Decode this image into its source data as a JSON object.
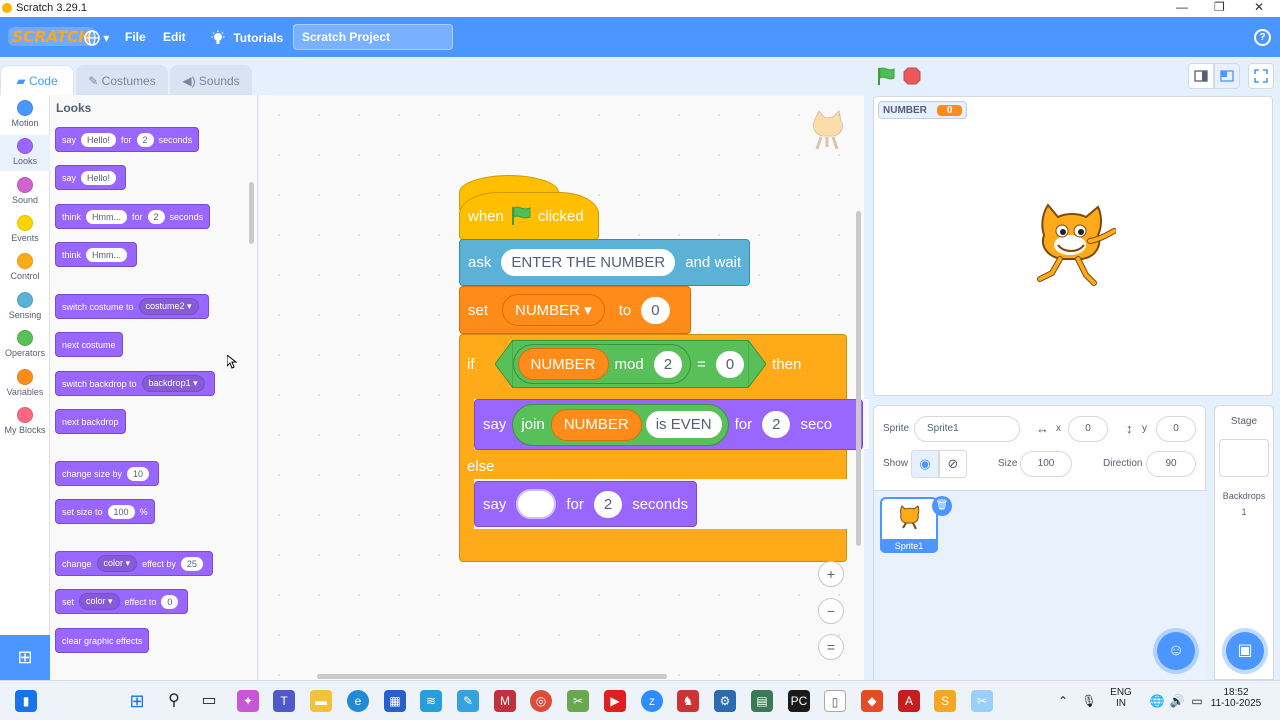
{
  "window": {
    "title": "Scratch 3.29.1",
    "minimize": "—",
    "maximize": "❐",
    "close": "✕"
  },
  "menubar": {
    "logo": "SCRATCH",
    "globe_arrow": "▾",
    "file": "File",
    "edit": "Edit",
    "tutorials": "Tutorials",
    "project_title": "Scratch Project",
    "help": "?"
  },
  "tabs": [
    {
      "label": "Code",
      "active": true
    },
    {
      "label": "Costumes",
      "active": false
    },
    {
      "label": "Sounds",
      "active": false
    }
  ],
  "categories": [
    {
      "label": "Motion",
      "color": "#4c97ff"
    },
    {
      "label": "Looks",
      "color": "#9966ff"
    },
    {
      "label": "Sound",
      "color": "#cf63cf"
    },
    {
      "label": "Events",
      "color": "#ffd500"
    },
    {
      "label": "Control",
      "color": "#ffab19"
    },
    {
      "label": "Sensing",
      "color": "#5cb1d6"
    },
    {
      "label": "Operators",
      "color": "#59c059"
    },
    {
      "label": "Variables",
      "color": "#ff8c1a"
    },
    {
      "label": "My Blocks",
      "color": "#ff6680"
    }
  ],
  "palette": {
    "title": "Looks",
    "blocks": {
      "say_for": [
        "say",
        "Hello!",
        "for",
        "2",
        "seconds"
      ],
      "say": [
        "say",
        "Hello!"
      ],
      "think_for": [
        "think",
        "Hmm...",
        "for",
        "2",
        "seconds"
      ],
      "think": [
        "think",
        "Hmm..."
      ],
      "switch_costume": [
        "switch costume to",
        "costume2 ▾"
      ],
      "next_costume": [
        "next costume"
      ],
      "switch_backdrop": [
        "switch backdrop to",
        "backdrop1 ▾"
      ],
      "next_backdrop": [
        "next backdrop"
      ],
      "change_size": [
        "change size by",
        "10"
      ],
      "set_size": [
        "set size to",
        "100",
        "%"
      ],
      "change_effect": [
        "change",
        "color ▾",
        "effect by",
        "25"
      ],
      "set_effect": [
        "set",
        "color ▾",
        "effect to",
        "0"
      ],
      "clear_effects": [
        "clear graphic effects"
      ]
    }
  },
  "script": {
    "hat": {
      "when": "when",
      "clicked": "clicked"
    },
    "ask": {
      "label": "ask",
      "value": "ENTER THE NUMBER",
      "suffix": "and wait"
    },
    "set": {
      "label": "set",
      "var": "NUMBER ▾",
      "to": "to",
      "value": "0"
    },
    "if": {
      "label": "if",
      "var": "NUMBER",
      "op": "mod",
      "divisor": "2",
      "eq": "=",
      "rhs": "0",
      "then": "then"
    },
    "say1": {
      "label": "say",
      "join": "join",
      "var": "NUMBER",
      "text": "is EVEN",
      "for": "for",
      "secs": "2",
      "seconds": "seco"
    },
    "else": "else",
    "say2": {
      "label": "say",
      "value": "",
      "for": "for",
      "secs": "2",
      "seconds": "seconds"
    }
  },
  "zoom": {
    "in": "+",
    "out": "−",
    "reset": "="
  },
  "stage": {
    "monitor_label": "NUMBER",
    "monitor_value": "0"
  },
  "sprite_info": {
    "sprite_label": "Sprite",
    "sprite_name": "Sprite1",
    "x_label": "x",
    "x_value": "0",
    "y_label": "y",
    "y_value": "0",
    "show_label": "Show",
    "size_label": "Size",
    "size_value": "100",
    "direction_label": "Direction",
    "direction_value": "90",
    "thumb_name": "Sprite1"
  },
  "stage_panel": {
    "title": "Stage",
    "backdrops_label": "Backdrops",
    "backdrops_count": "1"
  },
  "taskbar": {
    "lang_top": "ENG",
    "lang_bottom": "IN",
    "time": "18:52",
    "date": "11-10-2025"
  }
}
